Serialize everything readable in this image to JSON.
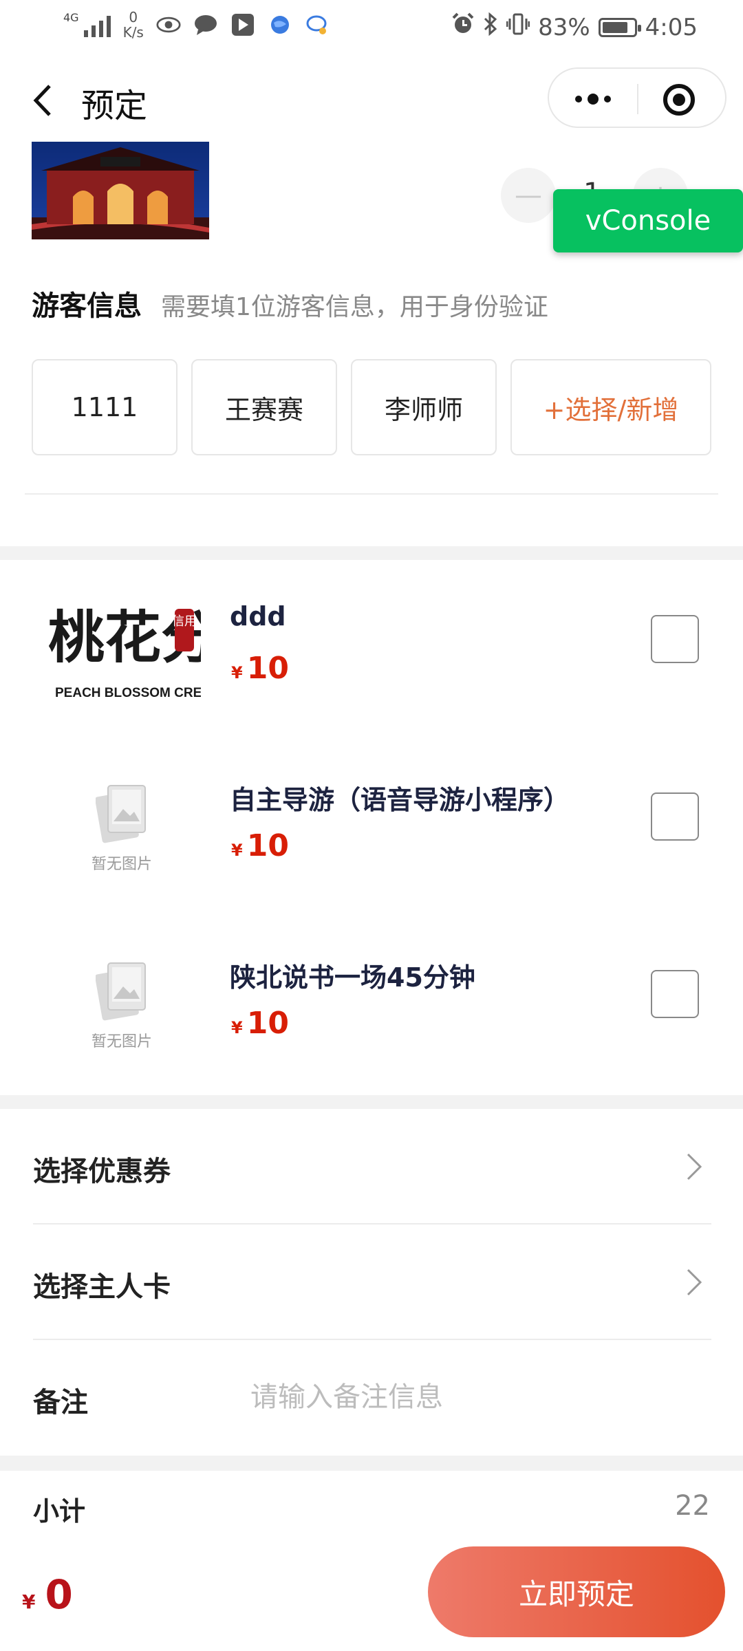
{
  "status_bar": {
    "network": "4G",
    "speed_value": "0",
    "speed_unit": "K/s",
    "battery": "83%",
    "battery_level": 0.83,
    "time": "4:05"
  },
  "nav": {
    "title": "预定"
  },
  "stepper": {
    "minus": "—",
    "value": "1",
    "plus": "+"
  },
  "vconsole": {
    "label": "vConsole"
  },
  "visitor": {
    "title": "游客信息",
    "hint": "需要填1位游客信息，用于身份验证",
    "chips": [
      "1111",
      "王赛赛",
      "李师师"
    ],
    "add_label": "+选择/新增"
  },
  "products": [
    {
      "name": "ddd",
      "currency": "¥",
      "price": "10",
      "logo_text": "桃花分",
      "logo_sub": "PEACH BLOSSOM CREDIT",
      "logo_seal": "信用"
    },
    {
      "name": "自主导游（语音导游小程序）",
      "currency": "¥",
      "price": "10",
      "noimg_label": "暂无图片"
    },
    {
      "name": "陕北说书一场45分钟",
      "currency": "¥",
      "price": "10",
      "noimg_label": "暂无图片"
    }
  ],
  "rows": {
    "coupon": "选择优惠券",
    "member_card": "选择主人卡",
    "remark_label": "备注",
    "remark_placeholder": "请输入备注信息"
  },
  "summary": {
    "subtotal_label": "小计",
    "subtotal_value": "22",
    "currency": "¥",
    "total": "0",
    "book_button": "立即预定"
  },
  "colors": {
    "price_red": "#d81e06",
    "accent_orange": "#e2703a",
    "vconsole_green": "#07c160",
    "button_gradient_start": "#ee7a6a",
    "button_gradient_end": "#e4512e"
  }
}
